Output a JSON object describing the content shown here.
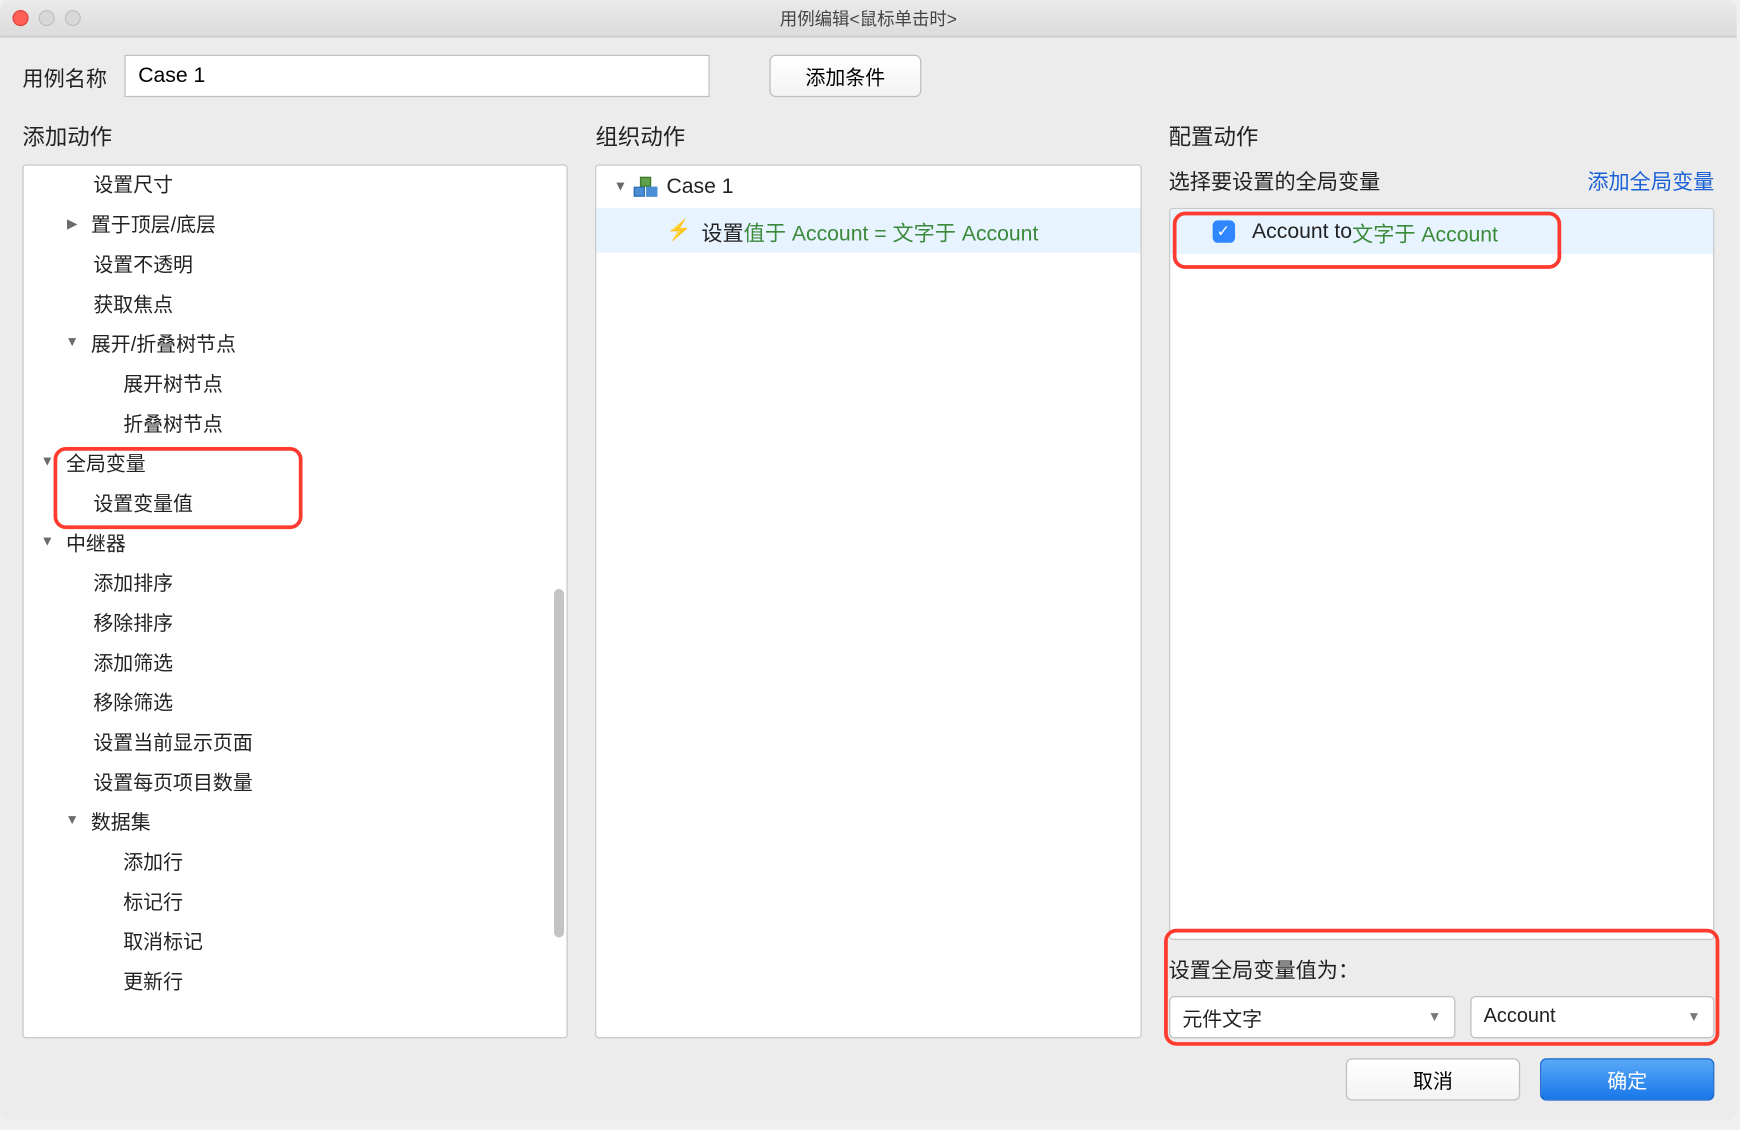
{
  "window": {
    "title": "用例编辑<鼠标单击时>"
  },
  "row_top": {
    "name_label": "用例名称",
    "name_value": "Case 1",
    "add_condition": "添加条件"
  },
  "columns": {
    "left_title": "添加动作",
    "mid_title": "组织动作",
    "right_title": "配置动作"
  },
  "tree": {
    "n0": "设置尺寸",
    "n1": "置于顶层/底层",
    "n2": "设置不透明",
    "n3": "获取焦点",
    "n4": "展开/折叠树节点",
    "n4a": "展开树节点",
    "n4b": "折叠树节点",
    "n5": "全局变量",
    "n5a": "设置变量值",
    "n6": "中继器",
    "n6a": "添加排序",
    "n6b": "移除排序",
    "n6c": "添加筛选",
    "n6d": "移除筛选",
    "n6e": "设置当前显示页面",
    "n6f": "设置每页项目数量",
    "n6g": "数据集",
    "n6g1": "添加行",
    "n6g2": "标记行",
    "n6g3": "取消标记",
    "n6g4": "更新行"
  },
  "mid": {
    "case_label": "Case 1",
    "action_prefix": "设置 ",
    "action_green": "值于 Account = 文字于 Account"
  },
  "right": {
    "select_var_label": "选择要设置的全局变量",
    "add_global_link": "添加全局变量",
    "var_row_prefix": "Account to ",
    "var_row_green": "文字于 Account",
    "set_value_label": "设置全局变量值为：",
    "select1": "元件文字",
    "select2": "Account"
  },
  "footer": {
    "cancel": "取消",
    "ok": "确定"
  }
}
